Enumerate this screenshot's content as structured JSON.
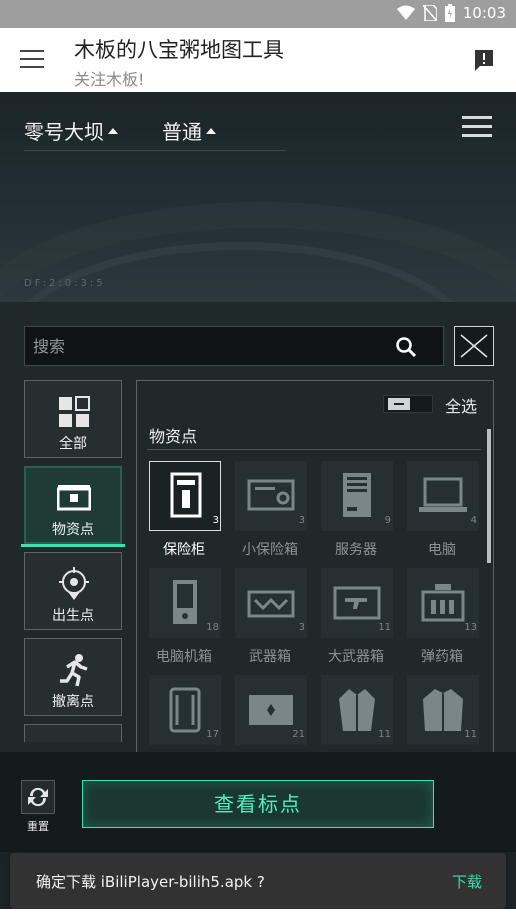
{
  "status_bar": {
    "time": "10:03"
  },
  "app_bar": {
    "title": "木板的八宝粥地图工具",
    "subtitle": "关注木板!",
    "menu_icon": "menu-icon",
    "alert_icon": "feedback-icon"
  },
  "map_header": {
    "map_dropdown": "零号大坝",
    "mode_dropdown": "普通",
    "map_code": "DF:2:0:3:5"
  },
  "search": {
    "placeholder": "搜索",
    "value": ""
  },
  "categories": [
    {
      "label": "全部",
      "icon": "grid-icon",
      "active": false
    },
    {
      "label": "物资点",
      "icon": "chest-icon",
      "active": true
    },
    {
      "label": "出生点",
      "icon": "location-pin-icon",
      "active": false
    },
    {
      "label": "撤离点",
      "icon": "running-man-icon",
      "active": false
    }
  ],
  "items_panel": {
    "select_all": "全选",
    "section_title": "物资点",
    "items": [
      {
        "name": "保险柜",
        "count": "3",
        "selected": true
      },
      {
        "name": "小保险箱",
        "count": "3",
        "selected": false
      },
      {
        "name": "服务器",
        "count": "9",
        "selected": false
      },
      {
        "name": "电脑",
        "count": "4",
        "selected": false
      },
      {
        "name": "电脑机箱",
        "count": "18",
        "selected": false
      },
      {
        "name": "武器箱",
        "count": "3",
        "selected": false
      },
      {
        "name": "大武器箱",
        "count": "11",
        "selected": false
      },
      {
        "name": "弹药箱",
        "count": "13",
        "selected": false
      },
      {
        "name": "",
        "count": "17",
        "selected": false
      },
      {
        "name": "",
        "count": "21",
        "selected": false
      },
      {
        "name": "",
        "count": "11",
        "selected": false
      },
      {
        "name": "",
        "count": "11",
        "selected": false
      }
    ]
  },
  "bottom_bar": {
    "reset_label": "重置",
    "view_button": "查看标点"
  },
  "snackbar": {
    "message": "确定下载 iBiliPlayer-bilih5.apk ?",
    "action": "下载"
  },
  "colors": {
    "accent": "#3fe0b0",
    "panel": "#20282a",
    "app_bar": "#ffffff"
  }
}
